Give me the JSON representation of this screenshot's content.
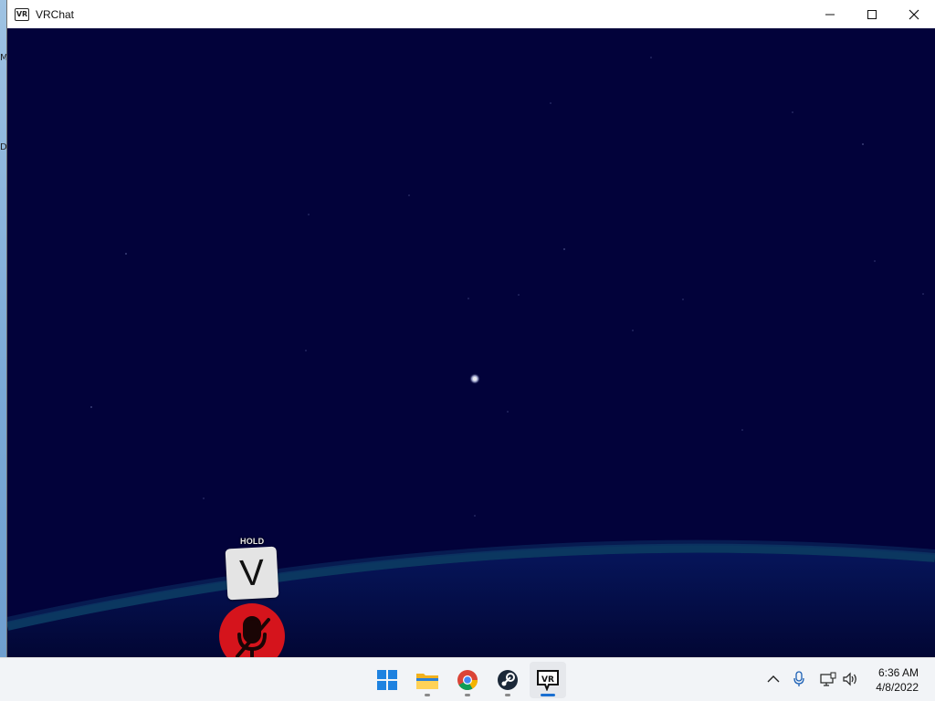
{
  "window": {
    "icon_text": "VR",
    "title": "VRChat",
    "controls": {
      "minimize": "—",
      "maximize": "☐",
      "close": "✕"
    }
  },
  "desktop": {
    "edge_glyph_top": "M",
    "edge_glyph_mid": "D"
  },
  "scene": {
    "hold_label": "HOLD",
    "key_label": "V",
    "background_color": "#02023a",
    "mic_badge_color": "#d5141c"
  },
  "taskbar": {
    "apps": [
      {
        "name": "Start",
        "icon": "windows-start-icon",
        "active": false
      },
      {
        "name": "File Explorer",
        "icon": "folder-icon",
        "active": false
      },
      {
        "name": "Google Chrome",
        "icon": "chrome-icon",
        "active": false
      },
      {
        "name": "Steam",
        "icon": "steam-icon",
        "active": false
      },
      {
        "name": "VRChat",
        "icon": "vrchat-icon",
        "icon_text": "VR",
        "active": true
      }
    ],
    "tray": {
      "overflow_chevron": "^",
      "icons": [
        "microphone-icon",
        "network-icon",
        "volume-icon"
      ]
    },
    "clock": {
      "time": "6:36 AM",
      "date": "4/8/2022"
    }
  }
}
